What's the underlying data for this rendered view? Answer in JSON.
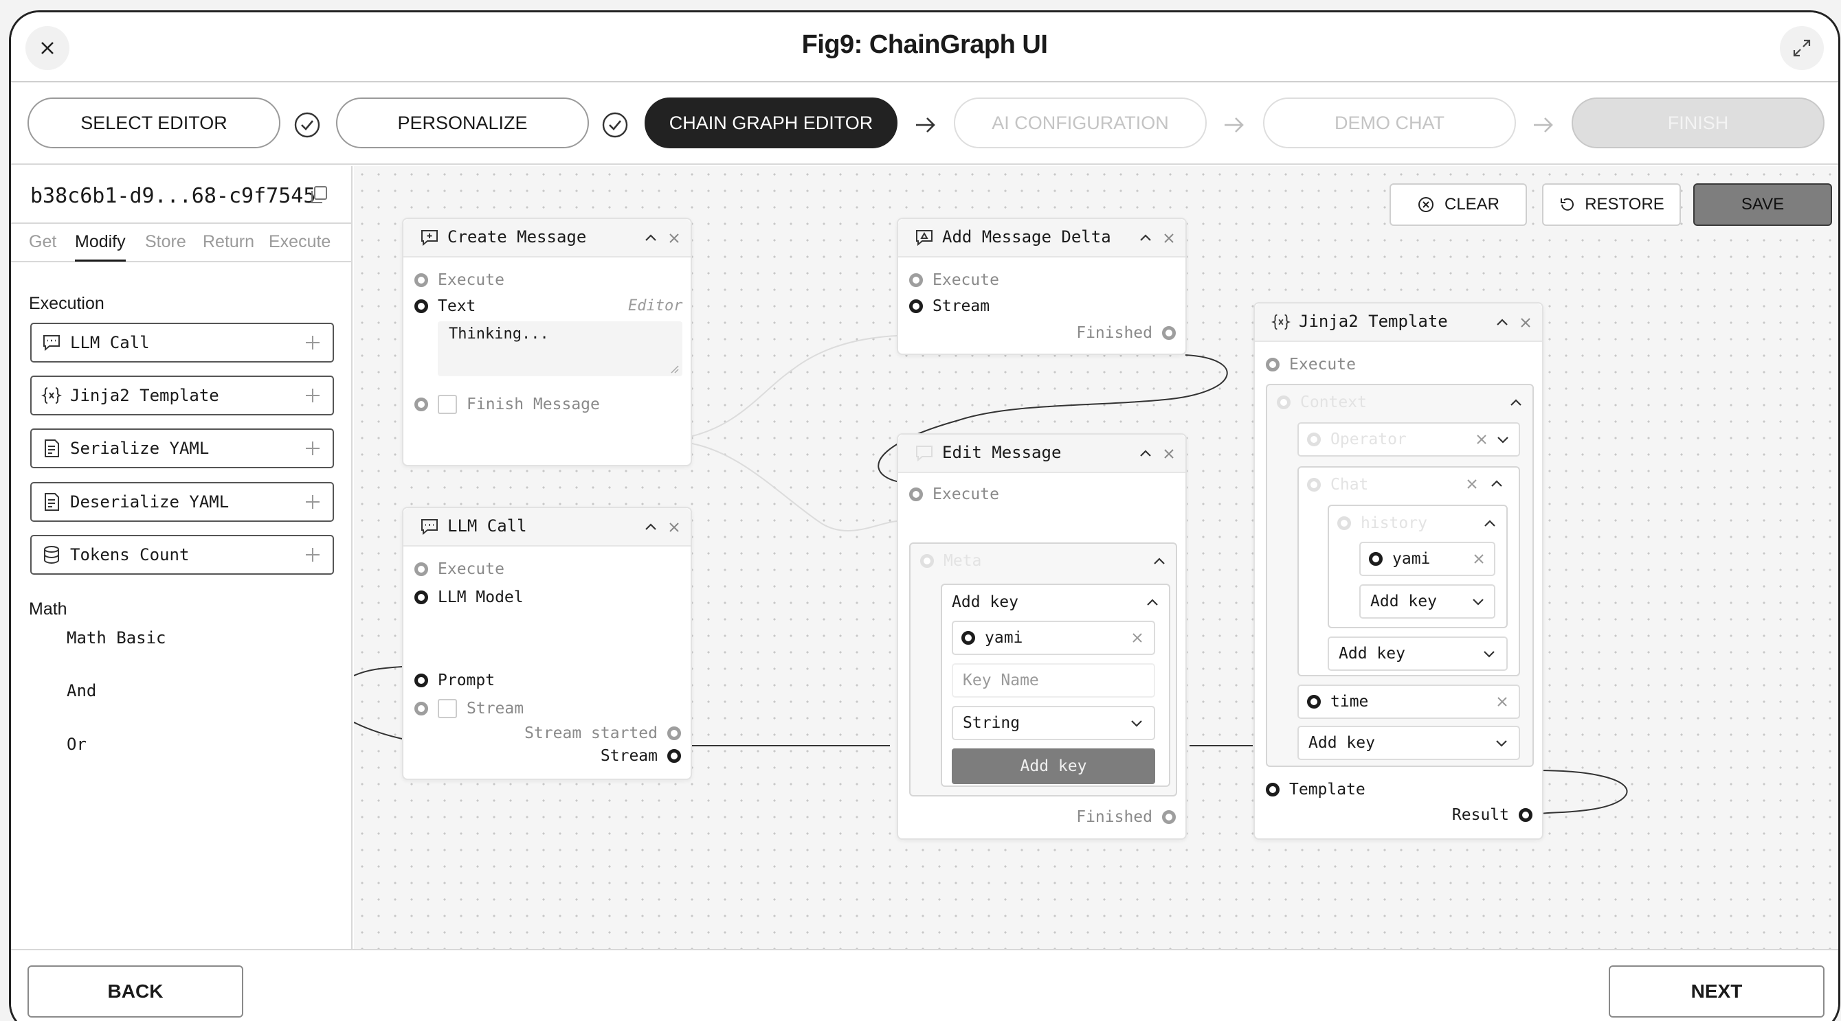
{
  "window": {
    "title": "Fig9: ChainGraph UI"
  },
  "steps": [
    {
      "label": "SELECT EDITOR",
      "state": "done"
    },
    {
      "label": "PERSONALIZE",
      "state": "done"
    },
    {
      "label": "CHAIN GRAPH EDITOR",
      "state": "active"
    },
    {
      "label": "AI CONFIGURATION",
      "state": "disabled"
    },
    {
      "label": "DEMO CHAT",
      "state": "disabled"
    },
    {
      "label": "FINISH",
      "state": "disabled"
    }
  ],
  "sidebar": {
    "flow_id": "b38c6b1-d9...68-c9f7545",
    "tabs": [
      "Get",
      "Modify",
      "Store",
      "Return",
      "Execute"
    ],
    "active_tab": "Modify",
    "execution_title": "Execution",
    "execution_items": [
      {
        "label": "LLM Call",
        "icon": "chat-icon"
      },
      {
        "label": "Jinja2 Template",
        "icon": "braces-icon"
      },
      {
        "label": "Serialize YAML",
        "icon": "document-icon"
      },
      {
        "label": "Deserialize YAML",
        "icon": "document-icon"
      },
      {
        "label": "Tokens Count",
        "icon": "database-icon"
      }
    ],
    "math_title": "Math",
    "math_items": [
      "Math Basic",
      "And",
      "Or"
    ]
  },
  "toolbar": {
    "clear": "CLEAR",
    "restore": "RESTORE",
    "save": "SAVE"
  },
  "nodes": {
    "create_message": {
      "title": "Create Message",
      "execute": "Execute",
      "text": "Text",
      "editor": "Editor",
      "text_value": "Thinking...",
      "finish": "Finish Message"
    },
    "llm_call": {
      "title": "LLM Call",
      "execute": "Execute",
      "model": "LLM Model",
      "prompt": "Prompt",
      "stream": "Stream",
      "stream_started": "Stream started",
      "stream_out": "Stream"
    },
    "add_delta": {
      "title": "Add Message Delta",
      "execute": "Execute",
      "stream": "Stream",
      "finished": "Finished"
    },
    "edit_message": {
      "title": "Edit Message",
      "execute": "Execute",
      "meta": "Meta",
      "add_key_header": "Add key",
      "key_chip": "yami",
      "key_name_placeholder": "Key Name",
      "type_value": "String",
      "add_key_button": "Add key",
      "finished": "Finished"
    },
    "jinja": {
      "title": "Jinja2 Template",
      "execute": "Execute",
      "context": "Context",
      "operator": "Operator",
      "chat": "Chat",
      "history": "history",
      "history_key": "yami",
      "history_add": "Add key",
      "chat_add": "Add key",
      "time_key": "time",
      "context_add": "Add key",
      "template": "Template",
      "result": "Result"
    }
  },
  "footer": {
    "back": "BACK",
    "next": "NEXT"
  }
}
